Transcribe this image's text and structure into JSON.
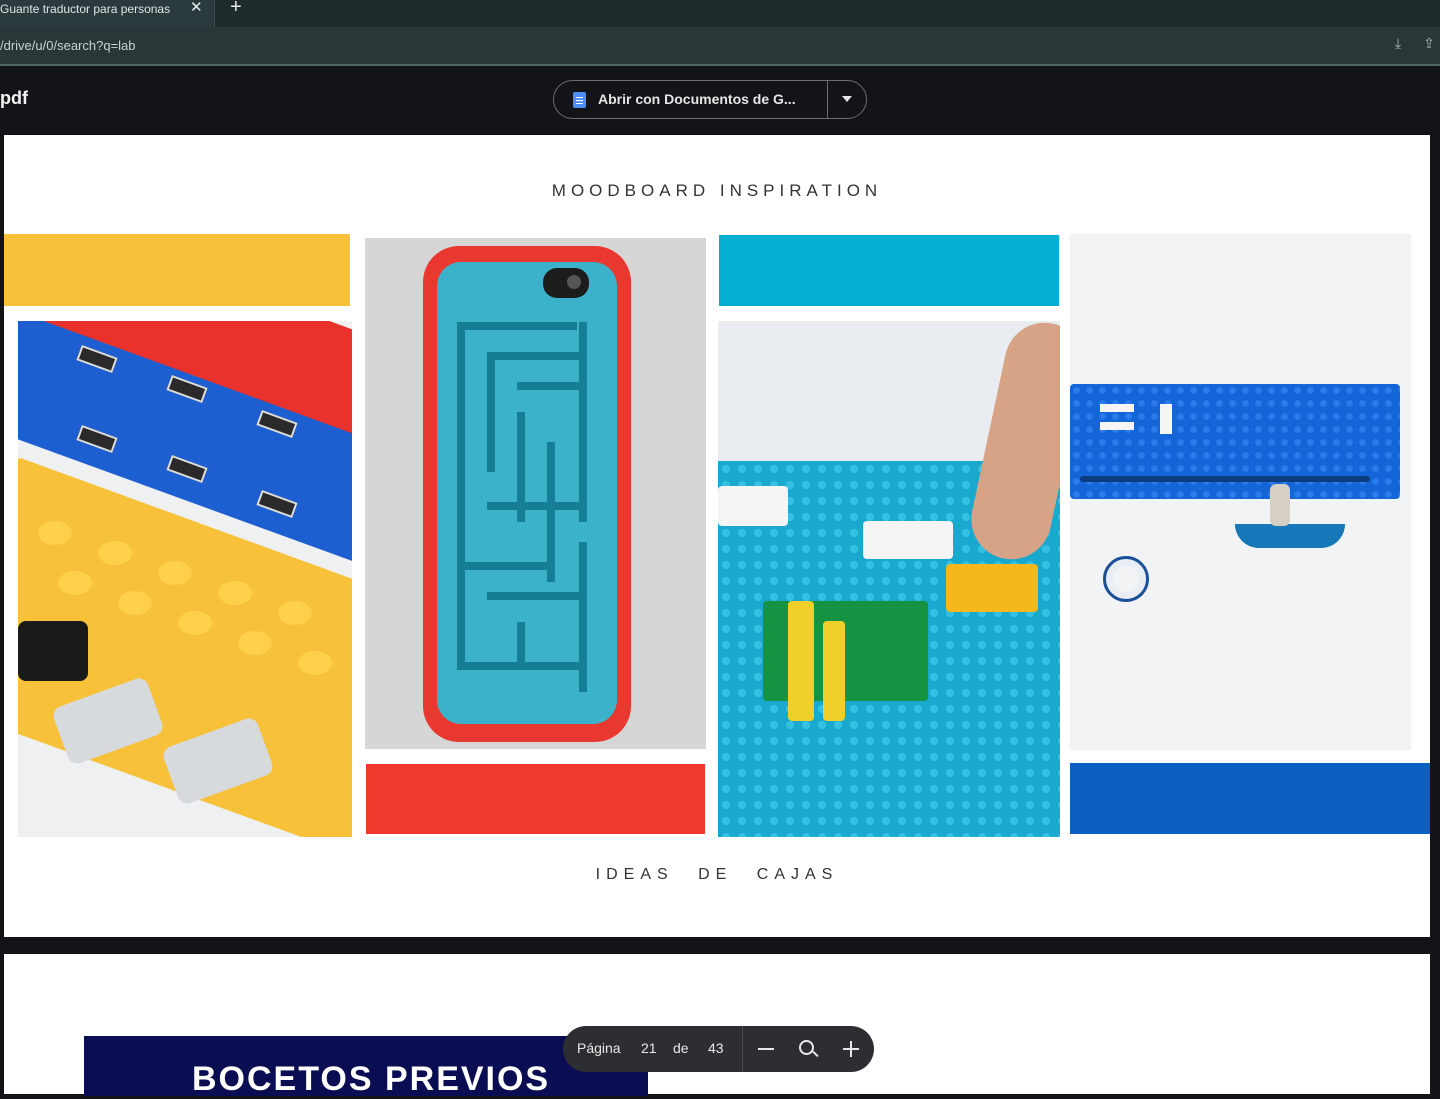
{
  "browser": {
    "tab_title": "Guante traductor para personas",
    "close_glyph": "✕",
    "new_tab_glyph": "+",
    "url": "/drive/u/0/search?q=lab"
  },
  "viewer": {
    "file_title": "pdf",
    "open_with_label": "Abrir con Documentos de G..."
  },
  "page": {
    "heading": "MOODBOARD INSPIRATION",
    "footer": "IDEAS DE CAJAS"
  },
  "palette": {
    "yellow": "#f7c23a",
    "red": "#f2392e",
    "cyan": "#06aed3",
    "blue": "#0d5fc2"
  },
  "page2": {
    "banner_text": "BOCETOS PREVIOS"
  },
  "pdf_toolbar": {
    "page_label": "Página",
    "current_page": "21",
    "of_label": "de",
    "total_pages": "43"
  },
  "icons": [
    "close-icon",
    "plus-icon",
    "download-icon",
    "share-icon",
    "docs-icon",
    "caret-down-icon",
    "zoom-out-icon",
    "zoom-icon",
    "zoom-in-icon"
  ]
}
